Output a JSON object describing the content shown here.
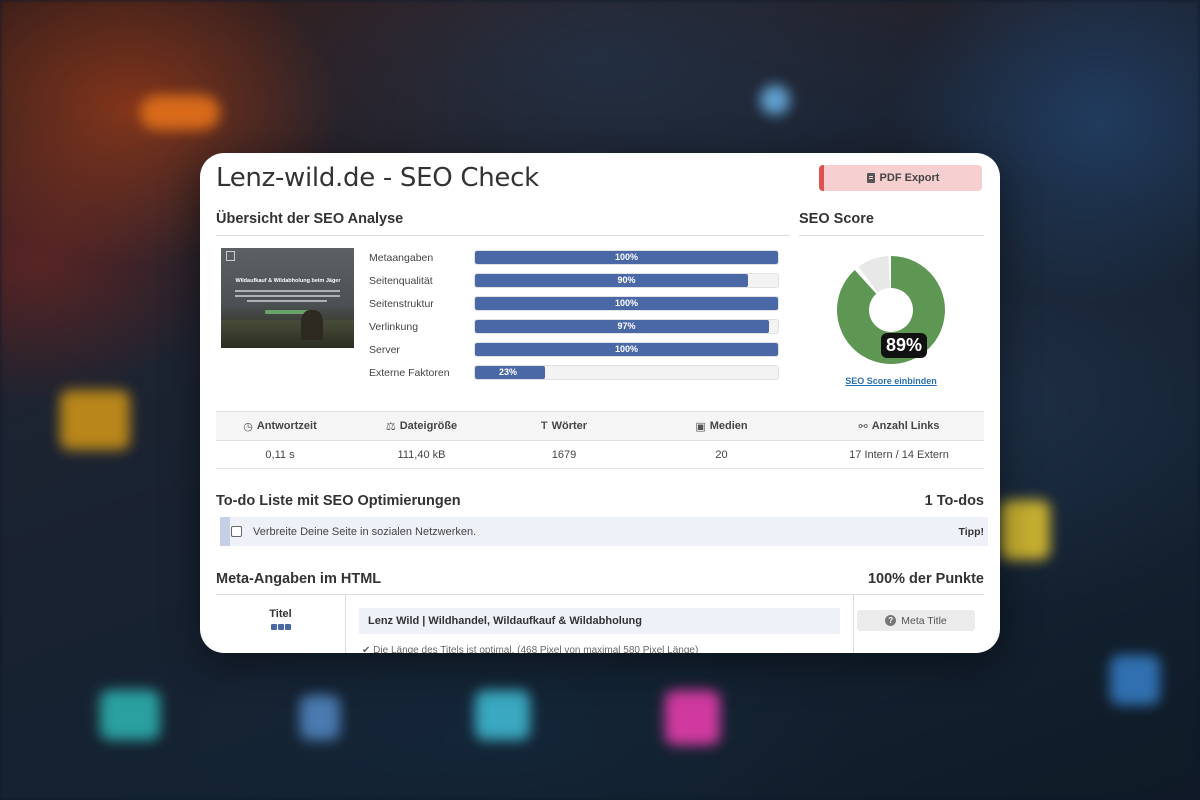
{
  "page_title": "Lenz-wild.de - SEO Check",
  "pdf_export_label": "PDF Export",
  "overview": {
    "heading": "Übersicht der SEO Analyse",
    "thumbnail_title": "Wildaufkauf & Wildabholung beim Jäger",
    "bars": [
      {
        "label": "Metaangaben",
        "value": 100,
        "text": "100%"
      },
      {
        "label": "Seitenqualität",
        "value": 90,
        "text": "90%"
      },
      {
        "label": "Seitenstruktur",
        "value": 100,
        "text": "100%"
      },
      {
        "label": "Verlinkung",
        "value": 97,
        "text": "97%"
      },
      {
        "label": "Server",
        "value": 100,
        "text": "100%"
      },
      {
        "label": "Externe Faktoren",
        "value": 23,
        "text": "23%"
      }
    ]
  },
  "score": {
    "heading": "SEO Score",
    "value": 89,
    "text": "89%",
    "fill_color": "#5e9653",
    "rest_color": "#e8e8e8",
    "embed_link": "SEO Score einbinden"
  },
  "stats": {
    "headers": [
      "Antwortzeit",
      "Dateigröße",
      "Wörter",
      "Medien",
      "Anzahl Links"
    ],
    "values": [
      "0,11 s",
      "111,40 kB",
      "1679",
      "20",
      "17 Intern / 14 Extern"
    ]
  },
  "todo": {
    "heading": "To-do Liste mit SEO Optimierungen",
    "count": "1 To-dos",
    "items": [
      {
        "text": "Verbreite Deine Seite in sozialen Netzwerken.",
        "tag": "Tipp!"
      }
    ]
  },
  "meta": {
    "heading": "Meta-Angaben im HTML",
    "points": "100% der Punkte",
    "row_label": "Titel",
    "title_value": "Lenz Wild | Wildhandel, Wildaufkauf & Wildabholung",
    "partial_note": "✔ Die Länge des Titels ist optimal. (468 Pixel von maximal 580 Pixel Länge)",
    "button_label": "Meta Title"
  },
  "colors": {
    "bar_fill": "#4a68a6",
    "pdf_button_bg": "#f6d0d0",
    "pdf_button_accent": "#e05252"
  }
}
